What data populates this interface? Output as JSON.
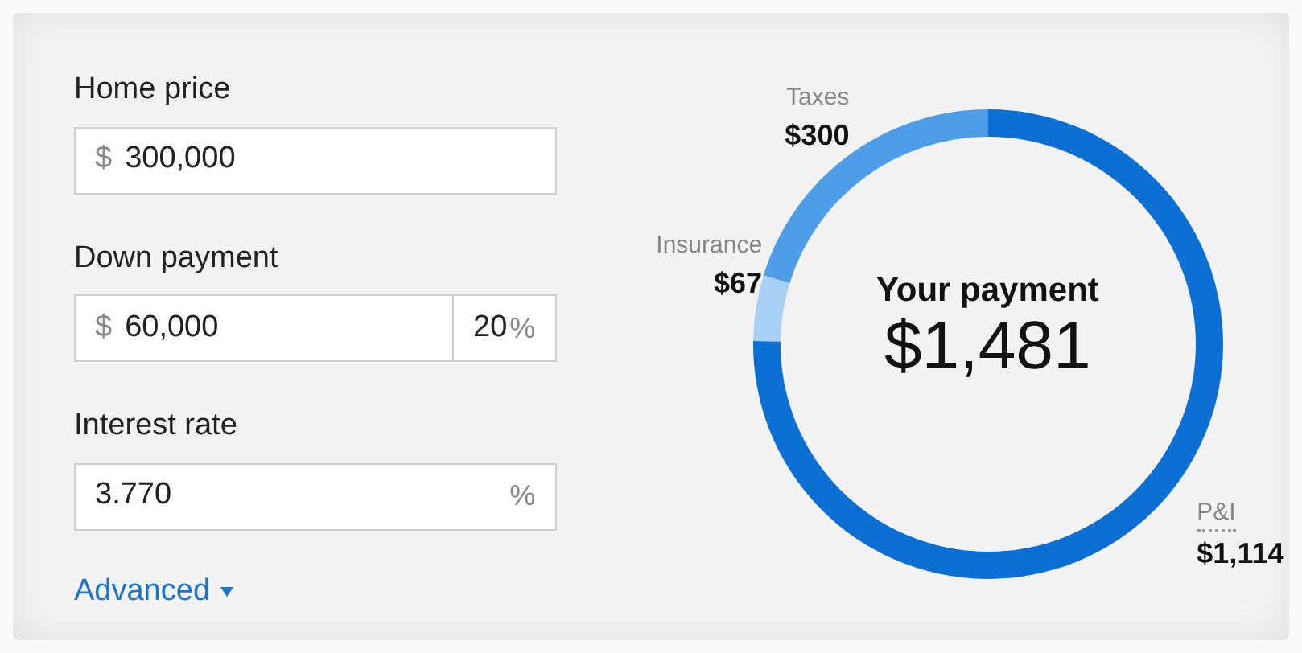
{
  "form": {
    "home_price": {
      "label": "Home price",
      "prefix": "$",
      "value": "300,000"
    },
    "down_payment": {
      "label": "Down payment",
      "prefix": "$",
      "value": "60,000",
      "percent_value": "20",
      "percent_suffix": "%"
    },
    "interest_rate": {
      "label": "Interest rate",
      "value": "3.770",
      "suffix": "%"
    },
    "advanced_link": {
      "label": "Advanced",
      "expanded": false
    }
  },
  "payment": {
    "title": "Your payment",
    "total": "$1,481",
    "segments": [
      {
        "color": "#0b6fd4",
        "underlined": true
      },
      {
        "color": "#a9d0f5",
        "underlined": false
      },
      {
        "color": "#4d9de9",
        "underlined": false
      }
    ],
    "chart_data": {
      "type": "donut",
      "categories": [
        "P&I",
        "Insurance",
        "Taxes"
      ],
      "values": [
        1114,
        67,
        300
      ],
      "value_labels": [
        "$1,114",
        "$67",
        "$300"
      ]
    }
  }
}
